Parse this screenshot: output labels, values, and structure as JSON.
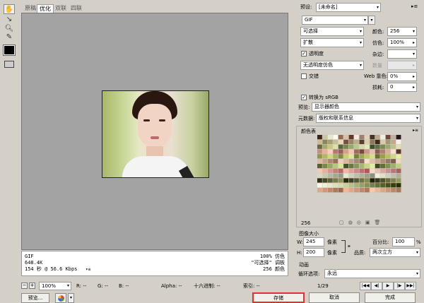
{
  "tabs": [
    "原稿",
    "优化",
    "双联",
    "四联"
  ],
  "active_tab": 1,
  "tools": [
    "hand-icon",
    "slice-select-icon",
    "zoom-icon",
    "eyedropper-icon"
  ],
  "info": {
    "format": "GIF",
    "size": "648.4K",
    "time": "154 秒 @ 56.6 Kbps",
    "dither": "100% 仿色",
    "palette": "\"可选择\" 调板",
    "colors": "256 颜色"
  },
  "status": {
    "zoom": "100%",
    "r": "R: --",
    "g": "G: --",
    "b": "B: --",
    "alpha": "Alpha: --",
    "hex": "十六进制: --",
    "index": "索引: --"
  },
  "bottom_buttons": {
    "preview": "预览...",
    "save": "存储",
    "cancel": "取消",
    "done": "完成"
  },
  "settings": {
    "preset_label": "预设:",
    "preset_value": "[未命名]",
    "format": "GIF",
    "reduction": "可选择",
    "dither_algo": "扩散",
    "transparency_label": "透明度",
    "transparency_dither": "无透明度仿色",
    "interlaced_label": "交错",
    "colors_label": "颜色:",
    "colors_value": "256",
    "dither_label": "仿色:",
    "dither_value": "100%",
    "matte_label": "杂边:",
    "amount_label": "数量",
    "web_snap_label": "Web 靠色:",
    "web_snap_value": "0%",
    "lossy_label": "损耗:",
    "lossy_value": "0",
    "convert_srgb_label": "转换为 sRGB",
    "preview_label": "预览:",
    "preview_value": "显示器颜色",
    "metadata_label": "元数据:",
    "metadata_value": "版权和联系信息"
  },
  "color_table": {
    "title": "颜色表",
    "count": "256"
  },
  "image_size": {
    "title": "图像大小",
    "w_label": "W:",
    "w_value": "245",
    "h_label": "H:",
    "h_value": "200",
    "unit": "像素",
    "percent_label": "百分比:",
    "percent_value": "100",
    "percent_unit": "%",
    "quality_label": "品质:",
    "quality_value": "两次立方"
  },
  "animation": {
    "title": "动画",
    "loop_label": "循环选项:",
    "loop_value": "永远",
    "frame": "1/29"
  },
  "palette_colors": [
    "#3a2418",
    "#c8c8a0",
    "#e8e8d0",
    "#fff8f0",
    "#986850",
    "#d8c0a8",
    "#603828",
    "#f8e8d8",
    "#a08070",
    "#e0d0b8",
    "#483020",
    "#b8a888",
    "#f0f0e0",
    "#704838",
    "#c0b0a0",
    "#281810",
    "#d0b890",
    "#888858",
    "#a8a070",
    "#c8c090",
    "#e8d8b8",
    "#785040",
    "#988860",
    "#b8b080",
    "#584030",
    "#d8d0a8",
    "#907858",
    "#402818",
    "#e0c8a8",
    "#a09878",
    "#c8a888",
    "#f8f0e8",
    "#686840",
    "#a8a868",
    "#c8c880",
    "#e0e0a0",
    "#586838",
    "#788850",
    "#98a868",
    "#b8c888",
    "#d8d8a8",
    "#e8e8b8",
    "#405028",
    "#607040",
    "#808858",
    "#a0a870",
    "#c0c088",
    "#e0e0b0",
    "#c89078",
    "#e8b098",
    "#f8d0c0",
    "#b87868",
    "#986050",
    "#d8a088",
    "#f0c8b0",
    "#a86858",
    "#784838",
    "#c89888",
    "#e8c0a8",
    "#905848",
    "#b08070",
    "#d8b098",
    "#f8e0d0",
    "#603028",
    "#909848",
    "#b0b860",
    "#d0d878",
    "#a8b058",
    "#888840",
    "#c8d070",
    "#e0e898",
    "#788038",
    "#a0a850",
    "#c0c868",
    "#d8e088",
    "#687030",
    "#98a048",
    "#b8c060",
    "#d0d880",
    "#e8f0a0",
    "#e0b8a0",
    "#c8a088",
    "#b08870",
    "#987058",
    "#f0d0b8",
    "#d8b8a0",
    "#c0a088",
    "#a88870",
    "#907060",
    "#f8e0c8",
    "#e0c0a8",
    "#c8a890",
    "#b09078",
    "#987860",
    "#806048",
    "#f0d8c0",
    "#586030",
    "#788848",
    "#98a860",
    "#b8c878",
    "#d8e890",
    "#485028",
    "#687840",
    "#889858",
    "#a8b870",
    "#c8d888",
    "#e0f0a0",
    "#404820",
    "#607038",
    "#809050",
    "#a0b068",
    "#c0d080",
    "#f8c8b0",
    "#e8b0a0",
    "#d89890",
    "#c88078",
    "#b86868",
    "#f0b8a8",
    "#e0a098",
    "#d08888",
    "#c07070",
    "#b05858",
    "#f8d8c8",
    "#e8c0b0",
    "#d8a8a0",
    "#c89090",
    "#b87878",
    "#a86060",
    "#d8d8c0",
    "#c8c8b0",
    "#b8b8a0",
    "#a8a890",
    "#989880",
    "#e8e8d0",
    "#d0d0b8",
    "#c0c0a8",
    "#b0b098",
    "#a0a088",
    "#909078",
    "#f0f0d8",
    "#e0e0c8",
    "#d0d0b8",
    "#c0c0a8",
    "#b0b098",
    "#303018",
    "#484828",
    "#606038",
    "#787848",
    "#909058",
    "#282810",
    "#404020",
    "#585830",
    "#707040",
    "#888850",
    "#202008",
    "#383818",
    "#505028",
    "#686838",
    "#808048",
    "#989858",
    "#f8f8e8",
    "#f0f0d8",
    "#e8e8c8",
    "#e0e0b8",
    "#d8d8a8",
    "#c8d098",
    "#b8c088",
    "#a8b078",
    "#98a068",
    "#889058",
    "#788048",
    "#687038",
    "#586028",
    "#485018",
    "#384008",
    "#283000",
    "#e0a888",
    "#d09878",
    "#c08868",
    "#b07858",
    "#a06848",
    "#f0b898",
    "#e0a888",
    "#d09878",
    "#c08868",
    "#b07858",
    "#f8c8a8",
    "#e8b898",
    "#d8a888",
    "#c89878",
    "#b88868",
    "#a87858"
  ]
}
